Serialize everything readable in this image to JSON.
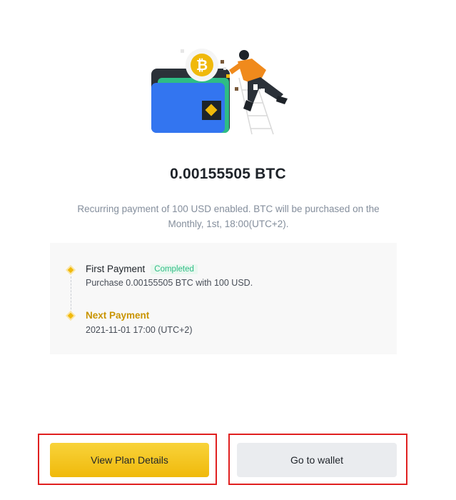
{
  "amount": "0.00155505 BTC",
  "description": "Recurring payment of 100 USD enabled. BTC will be purchased on the Monthly, 1st, 18:00(UTC+2).",
  "timeline": {
    "first": {
      "title": "First Payment",
      "badge": "Completed",
      "detail": "Purchase 0.00155505 BTC with 100 USD."
    },
    "next": {
      "title": "Next Payment",
      "detail": "2021-11-01 17:00 (UTC+2)"
    }
  },
  "buttons": {
    "view_plan": "View Plan Details",
    "go_wallet": "Go to wallet"
  },
  "colors": {
    "accent": "#f0b90b",
    "success": "#2ebd85",
    "highlight_box": "#e02020"
  },
  "icons": [
    "wallet-illustration",
    "bitcoin-coin-icon",
    "binance-diamond-icon"
  ]
}
